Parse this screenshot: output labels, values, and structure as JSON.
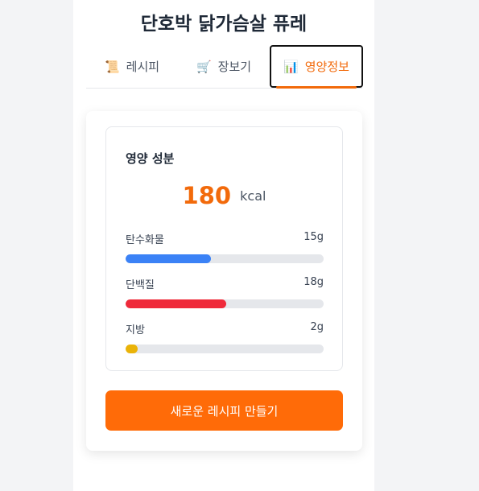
{
  "page": {
    "title": "단호박 닭가슴살 퓨레"
  },
  "tabs": [
    {
      "icon": "📜",
      "icon_name": "scroll-icon",
      "label": "레시피",
      "active": false
    },
    {
      "icon": "🛒",
      "icon_name": "shopping-cart-icon",
      "label": "장보기",
      "active": false
    },
    {
      "icon": "📊",
      "icon_name": "bar-chart-icon",
      "label": "영양정보",
      "active": true
    }
  ],
  "nutrition": {
    "heading": "영양 성분",
    "calories": "180",
    "calories_unit": "kcal",
    "items": [
      {
        "name": "탄수화물",
        "amount": "15g",
        "fill_fraction": 0.43,
        "color": "#3b82f6"
      },
      {
        "name": "단백질",
        "amount": "18g",
        "fill_fraction": 0.51,
        "color": "#ef2a3a"
      },
      {
        "name": "지방",
        "amount": "2g",
        "fill_fraction": 0.06,
        "color": "#eab308"
      }
    ]
  },
  "actions": {
    "new_recipe_label": "새로운 레시피 만들기"
  },
  "colors": {
    "accent": "#ff6b08",
    "text": "#1f2937"
  }
}
